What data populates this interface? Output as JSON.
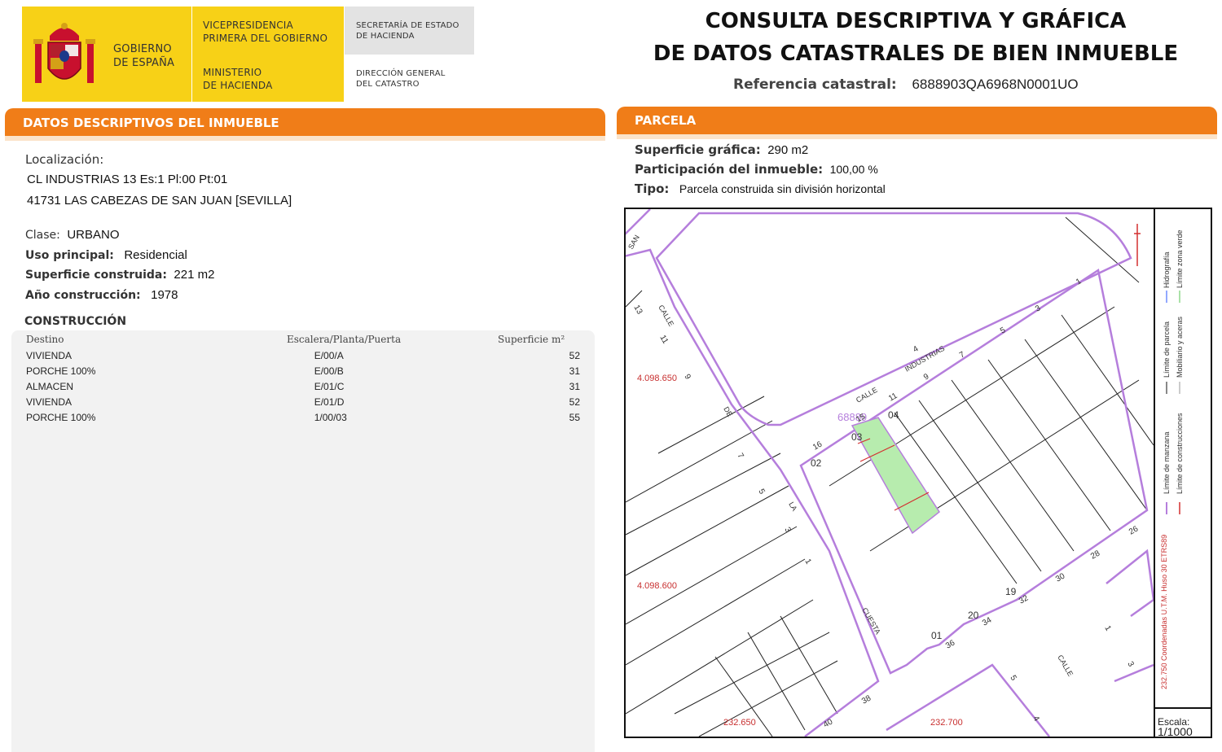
{
  "header": {
    "gobierno": [
      "GOBIERNO",
      "DE ESPAÑA"
    ],
    "vicepresidencia": [
      "VICEPRESIDENCIA",
      "PRIMERA DEL GOBIERNO"
    ],
    "ministerio": [
      "MINISTERIO",
      "DE HACIENDA"
    ],
    "secretaria": [
      "SECRETARÍA DE ESTADO",
      "DE HACIENDA"
    ],
    "direccion": [
      "DIRECCIÓN GENERAL",
      "DEL CATASTRO"
    ],
    "title_line1": "CONSULTA DESCRIPTIVA Y GRÁFICA",
    "title_line2": "DE DATOS CATASTRALES DE BIEN INMUEBLE",
    "ref_label": "Referencia catastral:",
    "ref_value": "6888903QA6968N0001UO"
  },
  "descriptivos": {
    "bar_title": "DATOS DESCRIPTIVOS DEL INMUEBLE",
    "localizacion_label": "Localización:",
    "address_line1": "CL INDUSTRIAS 13 Es:1 Pl:00 Pt:01",
    "address_line2": "41731 LAS CABEZAS DE SAN JUAN [SEVILLA]",
    "clase_label": "Clase:",
    "clase_value": "URBANO",
    "uso_label": "Uso principal:",
    "uso_value": "Residencial",
    "superficie_label": "Superficie construida:",
    "superficie_value": "221 m2",
    "anio_label": "Año construcción:",
    "anio_value": "1978",
    "construccion_title": "CONSTRUCCIÓN",
    "columns": [
      "Destino",
      "Escalera/Planta/Puerta",
      "Superficie m²"
    ],
    "rows": [
      [
        "VIVIENDA",
        "E/00/A",
        "52"
      ],
      [
        "PORCHE 100%",
        "E/00/B",
        "31"
      ],
      [
        "ALMACEN",
        "E/01/C",
        "31"
      ],
      [
        "VIVIENDA",
        "E/01/D",
        "52"
      ],
      [
        "PORCHE 100%",
        "1/00/03",
        "55"
      ]
    ]
  },
  "parcela": {
    "bar_title": "PARCELA",
    "sup_label": "Superficie gráfica:",
    "sup_value": "290 m2",
    "part_label": "Participación del inmueble:",
    "part_value": "100,00 %",
    "tipo_label": "Tipo:",
    "tipo_value": "Parcela construida sin división horizontal"
  },
  "map": {
    "coord_y1": "4.098.650",
    "coord_y2": "4.098.600",
    "coord_x1": "232.650",
    "coord_x2": "232.700",
    "parcel_ref": "68889",
    "street_labels": [
      "CALLE",
      "INDUSTRIAS",
      "CALLE",
      "DE",
      "LA",
      "CUESTA",
      "CALLE",
      "SAN"
    ],
    "numbers": [
      "1",
      "3",
      "5",
      "7",
      "9",
      "11",
      "4",
      "13",
      "11",
      "9",
      "7",
      "5",
      "3",
      "1",
      "15",
      "16",
      "02",
      "03",
      "04",
      "01",
      "19",
      "20",
      "26",
      "28",
      "30",
      "32",
      "34",
      "36",
      "38",
      "40",
      "1",
      "3",
      "5",
      "4"
    ],
    "legend": {
      "col1": [
        "Límite de manzana",
        "Límite de parcela",
        "Hidrografía"
      ],
      "col2": [
        "Límite de construcciones",
        "Mobiliario y aceras",
        "Límite zona verde"
      ],
      "utm": "232.750 Coordenadas U.T.M. Huso 30 ETRS89",
      "escala_label": "Escala:",
      "escala_value": "1/1000"
    },
    "colors": {
      "manzana": "#b57edc",
      "parcela": "#111111",
      "zona_verde": "#b7ecae",
      "construccion": "#d32f2f"
    }
  }
}
